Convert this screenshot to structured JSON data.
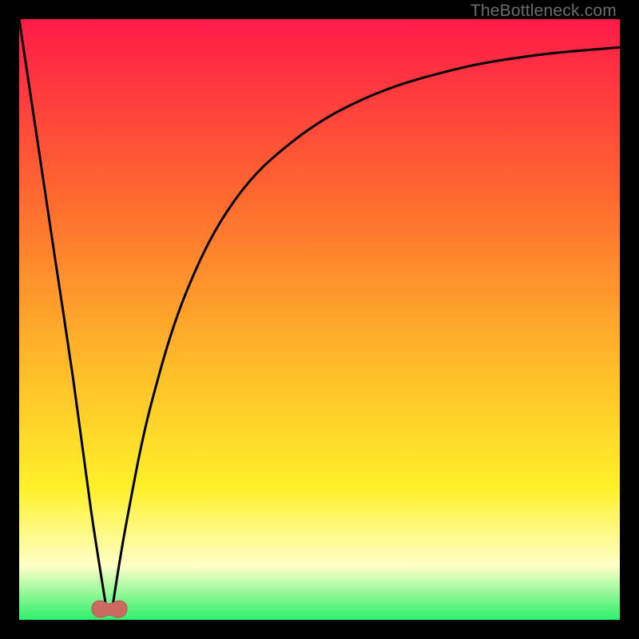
{
  "watermark": "TheBottleneck.com",
  "colors": {
    "gradient_top": "#ff1a49",
    "gradient_mid1": "#ff6a2f",
    "gradient_mid2": "#ffb42a",
    "gradient_mid3": "#fff029",
    "gradient_pale": "#ffffc8",
    "gradient_bottom": "#2cf06a",
    "curve": "#000000",
    "marker_fill": "#cc6a60",
    "marker_stroke": "#b95a52",
    "frame_bg": "#000000"
  },
  "chart_data": {
    "type": "line",
    "title": "",
    "xlabel": "",
    "ylabel": "",
    "xlim": [
      0,
      100
    ],
    "ylim": [
      0,
      100
    ],
    "note": "Bottleneck-style curve: a single V-shaped minimum near x≈15, rising steeply on the left and following a decaying asymptotic rise on the right. Values are pixel-estimated (no tick labels present).",
    "left_branch": {
      "x": [
        0,
        3,
        6,
        9,
        12,
        14.5
      ],
      "y": [
        100,
        80,
        60,
        40,
        18,
        2
      ]
    },
    "right_branch": {
      "x": [
        15.5,
        18,
        22,
        28,
        36,
        46,
        58,
        72,
        86,
        100
      ],
      "y": [
        2,
        17,
        36,
        55,
        70,
        80,
        87,
        91.5,
        94,
        95.3
      ]
    },
    "minimum_marker": {
      "x": 15,
      "y": 1.5
    }
  }
}
